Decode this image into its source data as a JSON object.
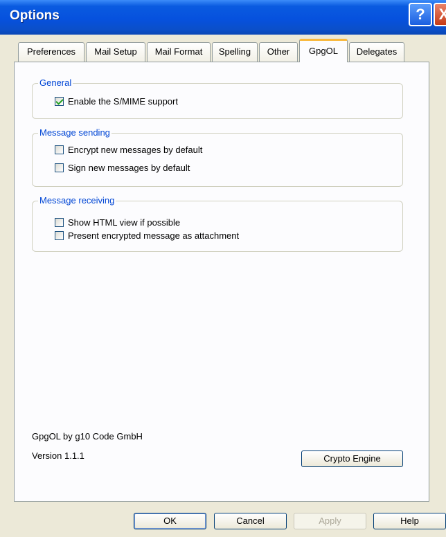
{
  "window": {
    "title": "Options"
  },
  "titlebar": {
    "help_glyph": "?",
    "close_glyph": "X"
  },
  "tabs": [
    {
      "label": "Preferences"
    },
    {
      "label": "Mail Setup"
    },
    {
      "label": "Mail Format"
    },
    {
      "label": "Spelling"
    },
    {
      "label": "Other"
    },
    {
      "label": "GpgOL",
      "active": true
    },
    {
      "label": "Delegates"
    }
  ],
  "groups": {
    "general": {
      "legend": "General",
      "items": [
        {
          "label": "Enable the S/MIME support",
          "checked": true
        }
      ]
    },
    "sending": {
      "legend": "Message sending",
      "items": [
        {
          "label": "Encrypt new messages by default",
          "checked": false
        },
        {
          "label": "Sign new messages by default",
          "checked": false
        }
      ]
    },
    "receiving": {
      "legend": "Message receiving",
      "items": [
        {
          "label": "Show HTML view if possible",
          "checked": false
        },
        {
          "label": "Present encrypted message as attachment",
          "checked": false
        }
      ]
    }
  },
  "about": {
    "line1": "GpgOL by g10 Code GmbH",
    "version": "Version 1.1.1"
  },
  "buttons": {
    "crypto_engine": "Crypto Engine",
    "ok": "OK",
    "cancel": "Cancel",
    "apply": "Apply",
    "help": "Help"
  },
  "colors": {
    "titlebar": "#0a5be0",
    "dialog_bg": "#ece9d8",
    "legend": "#0046d5",
    "active_tab_accent": "#f9b83c",
    "check": "#21a121"
  }
}
